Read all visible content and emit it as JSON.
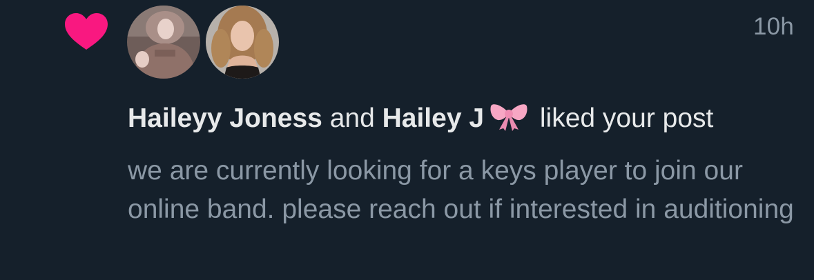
{
  "notification": {
    "type_icon": "heart-icon",
    "accent_color": "#f91880",
    "timestamp": "10h",
    "users": [
      {
        "name": "Haileyy Joness",
        "avatar": "avatar-photo"
      },
      {
        "name": "Hailey J",
        "name_emoji": "ribbon-bow-emoji",
        "avatar": "avatar-photo"
      }
    ],
    "connector": "and",
    "action": "liked your post",
    "post_text": "we are currently looking for a keys player to join our online band. please reach out if interested in auditioning"
  }
}
